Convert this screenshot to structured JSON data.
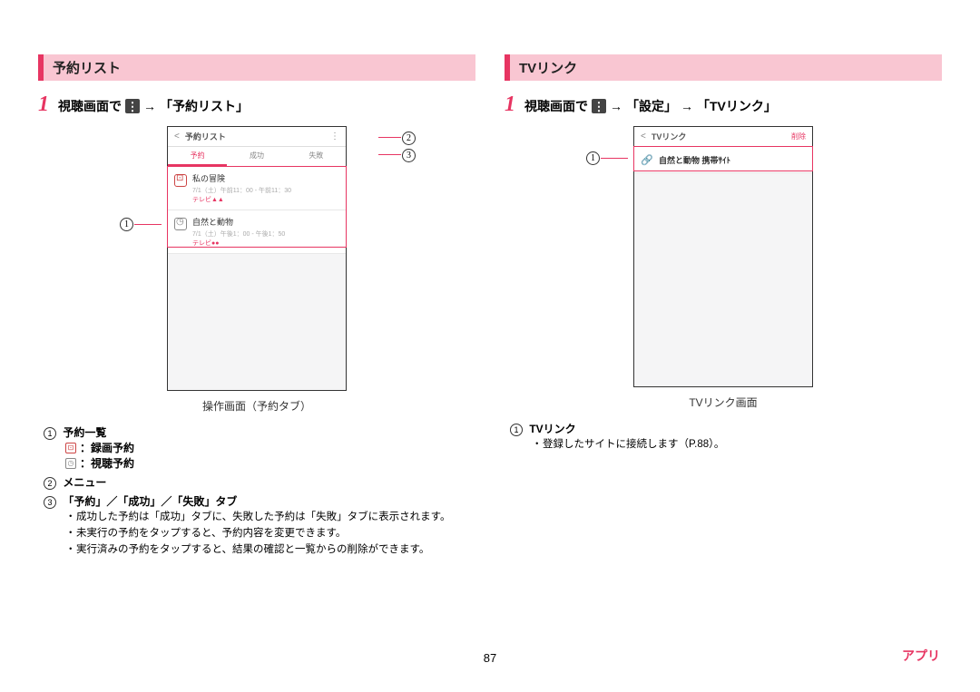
{
  "page_number": "87",
  "footer": "アプリ",
  "left": {
    "header": "予約リスト",
    "step_prefix": "視聴画面で",
    "step_arrow": "→",
    "step_target": "「予約リスト」",
    "caption": "操作画面（予約タブ）",
    "phone": {
      "title": "予約リスト",
      "tabs": [
        "予約",
        "成功",
        "失敗"
      ],
      "items": [
        {
          "title": "私の冒険",
          "sub": "7/1（土）午前11：00 - 午前11：30",
          "channel": "テレビ▲▲"
        },
        {
          "title": "自然と動物",
          "sub": "7/1（土）午後1：00 - 午後1：50",
          "channel": "テレビ●●"
        }
      ]
    },
    "desc": {
      "i1_title": "予約一覧",
      "i1_sub1": "：録画予約",
      "i1_sub2": "：視聴予約",
      "i2_title": "メニュー",
      "i3_title": "「予約」／「成功」／「失敗」タブ",
      "bullets": [
        "成功した予約は「成功」タブに、失敗した予約は「失敗」タブに表示されます。",
        "未実行の予約をタップすると、予約内容を変更できます。",
        "実行済みの予約をタップすると、結果の確認と一覧からの削除ができます。"
      ]
    }
  },
  "right": {
    "header": "TVリンク",
    "step_prefix": "視聴画面で",
    "step_arrow": "→",
    "step_mid": "「設定」",
    "step_target": "「TVリンク」",
    "caption": "TVリンク画面",
    "phone": {
      "title": "TVリンク",
      "delete": "削除",
      "items": [
        {
          "title": "自然と動物 携帯ｻｲﾄ"
        }
      ]
    },
    "desc": {
      "i1_title": "TVリンク",
      "bullets": [
        "登録したサイトに接続します（P.88）。"
      ]
    }
  }
}
